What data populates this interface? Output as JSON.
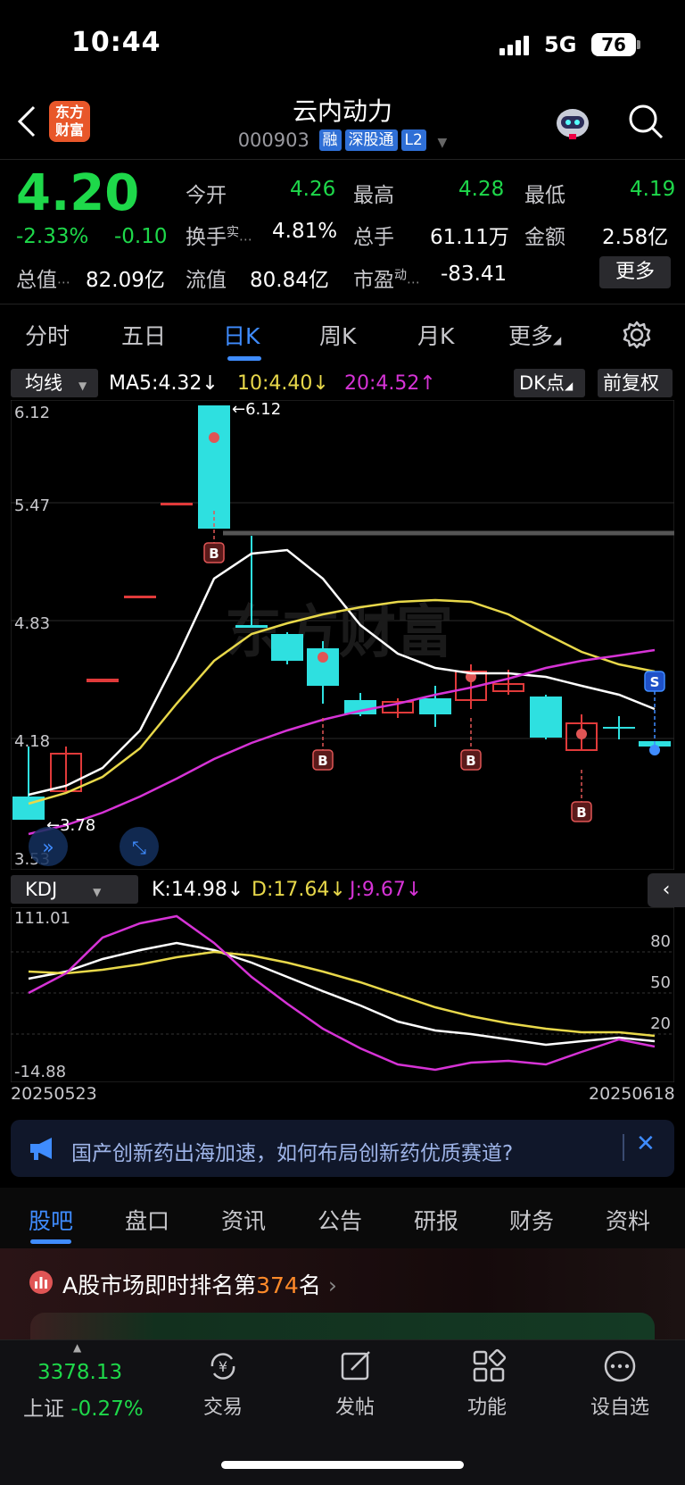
{
  "status": {
    "time": "10:44",
    "network": "5G",
    "battery": "76"
  },
  "header": {
    "title": "云内动力",
    "code": "000903",
    "tags": [
      "融",
      "深股通",
      "L2"
    ],
    "logo": "东方\n财富",
    "back_icon": "chevron-left-icon",
    "search_icon": "search-icon"
  },
  "quote": {
    "price": "4.20",
    "pct": "-2.33%",
    "chg": "-0.10",
    "open_label": "今开",
    "open": "4.26",
    "high_label": "最高",
    "high": "4.28",
    "low_label": "最低",
    "low": "4.19",
    "turnover_label": "换手",
    "turnover_sup": "实",
    "turnover": "4.81%",
    "volume_label": "总手",
    "volume": "61.11万",
    "amount_label": "金额",
    "amount": "2.58亿",
    "mktcap_label": "总值",
    "mktcap": "82.09亿",
    "float_label": "流值",
    "float": "80.84亿",
    "pe_label": "市盈",
    "pe_sup": "动",
    "pe": "-83.41",
    "more_button": "更多"
  },
  "tabs": [
    {
      "label": "分时"
    },
    {
      "label": "五日"
    },
    {
      "label": "日K"
    },
    {
      "label": "周K"
    },
    {
      "label": "月K"
    },
    {
      "label": "更多"
    }
  ],
  "kline": {
    "ma_selector": "均线",
    "ma5": "MA5:4.32↓",
    "ma10": "10:4.40↓",
    "ma20": "20:4.52↑",
    "dk_button": "DK点",
    "adjust_button": "前复权",
    "y_labels": [
      "6.12",
      "5.47",
      "4.83",
      "4.18",
      "3.53"
    ],
    "high_annot": "6.12",
    "low_annot": "3.78",
    "marker_buy": "B",
    "marker_sell": "S",
    "colors": {
      "up": "#e03a3a",
      "down": "#2ee0e0",
      "ma5": "#ffffff",
      "ma10": "#e8d84a",
      "ma20": "#d633d6"
    },
    "watermark": "东方财富"
  },
  "kdj": {
    "selector": "KDJ",
    "k": "K:14.98↓",
    "d": "D:17.64↓",
    "j": "J:9.67↓",
    "y_top": "111.01",
    "y_bottom": "-14.88",
    "levels": [
      "80",
      "50",
      "20"
    ],
    "date_start": "20250523",
    "date_end": "20250618"
  },
  "banner": {
    "text": "国产创新药出海加速，如何布局创新药优质赛道?"
  },
  "section_tabs": [
    {
      "label": "股吧"
    },
    {
      "label": "盘口"
    },
    {
      "label": "资讯"
    },
    {
      "label": "公告"
    },
    {
      "label": "研报"
    },
    {
      "label": "财务"
    },
    {
      "label": "资料"
    }
  ],
  "rank": {
    "prefix": "A股市场即时排名第",
    "num": "374",
    "suffix": "名"
  },
  "bottom": {
    "index_value": "3378.13",
    "index_name": "上证",
    "index_pct": "-0.27%",
    "items": [
      {
        "label": "交易",
        "icon": "yen-exchange-icon"
      },
      {
        "label": "发帖",
        "icon": "edit-icon"
      },
      {
        "label": "功能",
        "icon": "grid-icon"
      },
      {
        "label": "设自选",
        "icon": "more-dots-icon"
      }
    ]
  }
}
